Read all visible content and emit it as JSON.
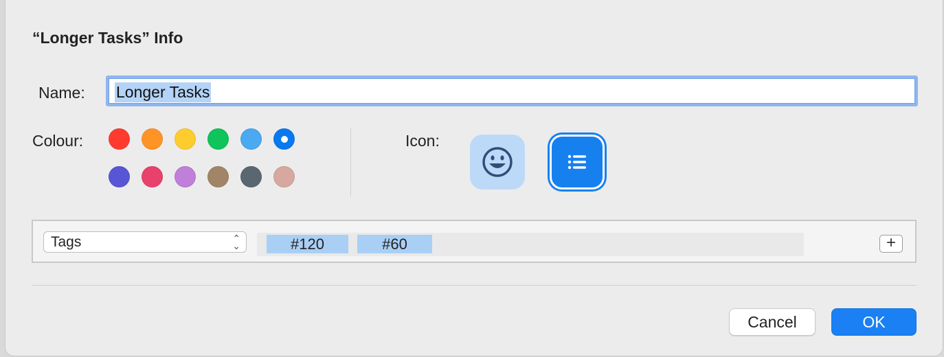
{
  "dialog": {
    "title": "“Longer Tasks” Info",
    "name_label": "Name:",
    "name_value": "Longer Tasks",
    "colour_label": "Colour:",
    "icon_label": "Icon:",
    "colours": [
      {
        "name": "red",
        "hex": "#ff3b30"
      },
      {
        "name": "orange",
        "hex": "#ff9426"
      },
      {
        "name": "yellow",
        "hex": "#ffcc2e"
      },
      {
        "name": "green",
        "hex": "#0fc45b"
      },
      {
        "name": "light-blue",
        "hex": "#4aa9f0"
      },
      {
        "name": "blue",
        "hex": "#0a79ef",
        "selected": true
      },
      {
        "name": "indigo",
        "hex": "#5856d6"
      },
      {
        "name": "pink",
        "hex": "#e8416b"
      },
      {
        "name": "purple",
        "hex": "#c07fd8"
      },
      {
        "name": "brown",
        "hex": "#a08567"
      },
      {
        "name": "graphite",
        "hex": "#5b6770"
      },
      {
        "name": "rose",
        "hex": "#d6a8a0"
      }
    ],
    "icons": [
      {
        "name": "smiley-icon",
        "selected": false
      },
      {
        "name": "list-icon",
        "selected": true
      }
    ],
    "tags": {
      "selector_label": "Tags",
      "tokens": [
        "#120",
        "#60"
      ],
      "add_label": "+"
    },
    "buttons": {
      "cancel": "Cancel",
      "ok": "OK"
    },
    "accent_color": "#1a80f3"
  }
}
